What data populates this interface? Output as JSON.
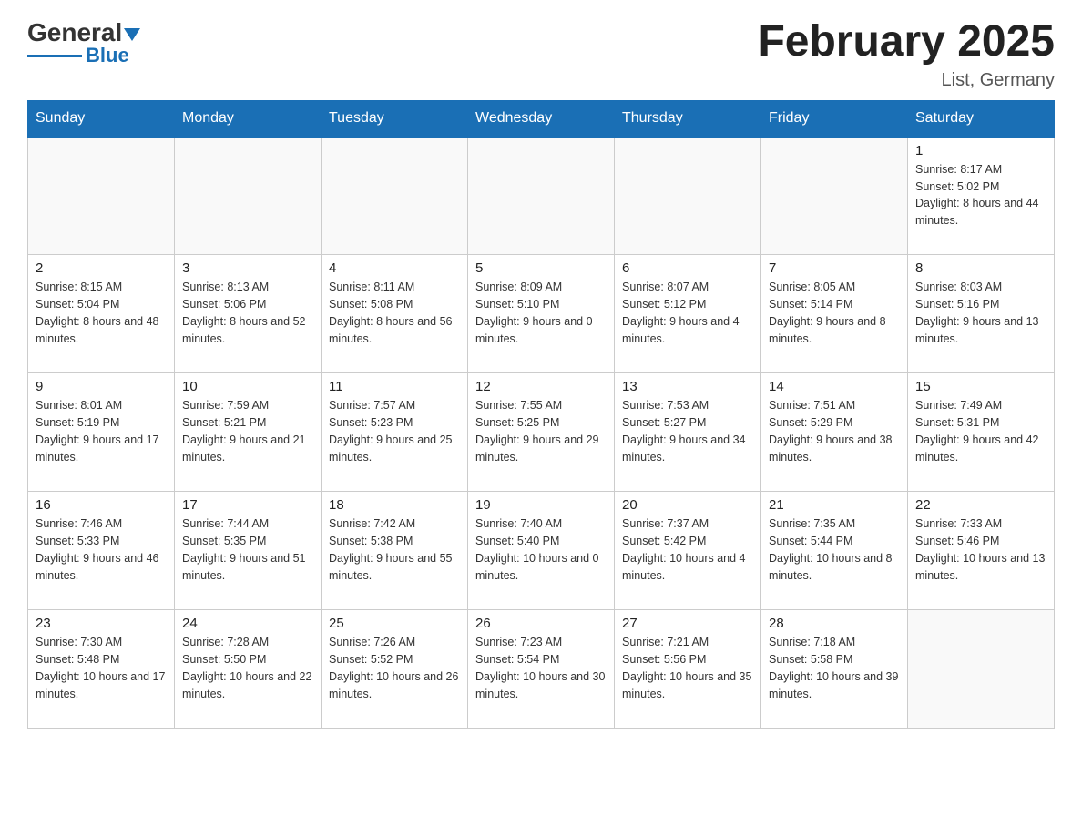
{
  "header": {
    "logo": {
      "text_general": "General",
      "text_blue": "Blue"
    },
    "title": "February 2025",
    "location": "List, Germany"
  },
  "calendar": {
    "days_of_week": [
      "Sunday",
      "Monday",
      "Tuesday",
      "Wednesday",
      "Thursday",
      "Friday",
      "Saturday"
    ],
    "weeks": [
      [
        {
          "day": "",
          "info": ""
        },
        {
          "day": "",
          "info": ""
        },
        {
          "day": "",
          "info": ""
        },
        {
          "day": "",
          "info": ""
        },
        {
          "day": "",
          "info": ""
        },
        {
          "day": "",
          "info": ""
        },
        {
          "day": "1",
          "info": "Sunrise: 8:17 AM\nSunset: 5:02 PM\nDaylight: 8 hours and 44 minutes."
        }
      ],
      [
        {
          "day": "2",
          "info": "Sunrise: 8:15 AM\nSunset: 5:04 PM\nDaylight: 8 hours and 48 minutes."
        },
        {
          "day": "3",
          "info": "Sunrise: 8:13 AM\nSunset: 5:06 PM\nDaylight: 8 hours and 52 minutes."
        },
        {
          "day": "4",
          "info": "Sunrise: 8:11 AM\nSunset: 5:08 PM\nDaylight: 8 hours and 56 minutes."
        },
        {
          "day": "5",
          "info": "Sunrise: 8:09 AM\nSunset: 5:10 PM\nDaylight: 9 hours and 0 minutes."
        },
        {
          "day": "6",
          "info": "Sunrise: 8:07 AM\nSunset: 5:12 PM\nDaylight: 9 hours and 4 minutes."
        },
        {
          "day": "7",
          "info": "Sunrise: 8:05 AM\nSunset: 5:14 PM\nDaylight: 9 hours and 8 minutes."
        },
        {
          "day": "8",
          "info": "Sunrise: 8:03 AM\nSunset: 5:16 PM\nDaylight: 9 hours and 13 minutes."
        }
      ],
      [
        {
          "day": "9",
          "info": "Sunrise: 8:01 AM\nSunset: 5:19 PM\nDaylight: 9 hours and 17 minutes."
        },
        {
          "day": "10",
          "info": "Sunrise: 7:59 AM\nSunset: 5:21 PM\nDaylight: 9 hours and 21 minutes."
        },
        {
          "day": "11",
          "info": "Sunrise: 7:57 AM\nSunset: 5:23 PM\nDaylight: 9 hours and 25 minutes."
        },
        {
          "day": "12",
          "info": "Sunrise: 7:55 AM\nSunset: 5:25 PM\nDaylight: 9 hours and 29 minutes."
        },
        {
          "day": "13",
          "info": "Sunrise: 7:53 AM\nSunset: 5:27 PM\nDaylight: 9 hours and 34 minutes."
        },
        {
          "day": "14",
          "info": "Sunrise: 7:51 AM\nSunset: 5:29 PM\nDaylight: 9 hours and 38 minutes."
        },
        {
          "day": "15",
          "info": "Sunrise: 7:49 AM\nSunset: 5:31 PM\nDaylight: 9 hours and 42 minutes."
        }
      ],
      [
        {
          "day": "16",
          "info": "Sunrise: 7:46 AM\nSunset: 5:33 PM\nDaylight: 9 hours and 46 minutes."
        },
        {
          "day": "17",
          "info": "Sunrise: 7:44 AM\nSunset: 5:35 PM\nDaylight: 9 hours and 51 minutes."
        },
        {
          "day": "18",
          "info": "Sunrise: 7:42 AM\nSunset: 5:38 PM\nDaylight: 9 hours and 55 minutes."
        },
        {
          "day": "19",
          "info": "Sunrise: 7:40 AM\nSunset: 5:40 PM\nDaylight: 10 hours and 0 minutes."
        },
        {
          "day": "20",
          "info": "Sunrise: 7:37 AM\nSunset: 5:42 PM\nDaylight: 10 hours and 4 minutes."
        },
        {
          "day": "21",
          "info": "Sunrise: 7:35 AM\nSunset: 5:44 PM\nDaylight: 10 hours and 8 minutes."
        },
        {
          "day": "22",
          "info": "Sunrise: 7:33 AM\nSunset: 5:46 PM\nDaylight: 10 hours and 13 minutes."
        }
      ],
      [
        {
          "day": "23",
          "info": "Sunrise: 7:30 AM\nSunset: 5:48 PM\nDaylight: 10 hours and 17 minutes."
        },
        {
          "day": "24",
          "info": "Sunrise: 7:28 AM\nSunset: 5:50 PM\nDaylight: 10 hours and 22 minutes."
        },
        {
          "day": "25",
          "info": "Sunrise: 7:26 AM\nSunset: 5:52 PM\nDaylight: 10 hours and 26 minutes."
        },
        {
          "day": "26",
          "info": "Sunrise: 7:23 AM\nSunset: 5:54 PM\nDaylight: 10 hours and 30 minutes."
        },
        {
          "day": "27",
          "info": "Sunrise: 7:21 AM\nSunset: 5:56 PM\nDaylight: 10 hours and 35 minutes."
        },
        {
          "day": "28",
          "info": "Sunrise: 7:18 AM\nSunset: 5:58 PM\nDaylight: 10 hours and 39 minutes."
        },
        {
          "day": "",
          "info": ""
        }
      ]
    ]
  }
}
